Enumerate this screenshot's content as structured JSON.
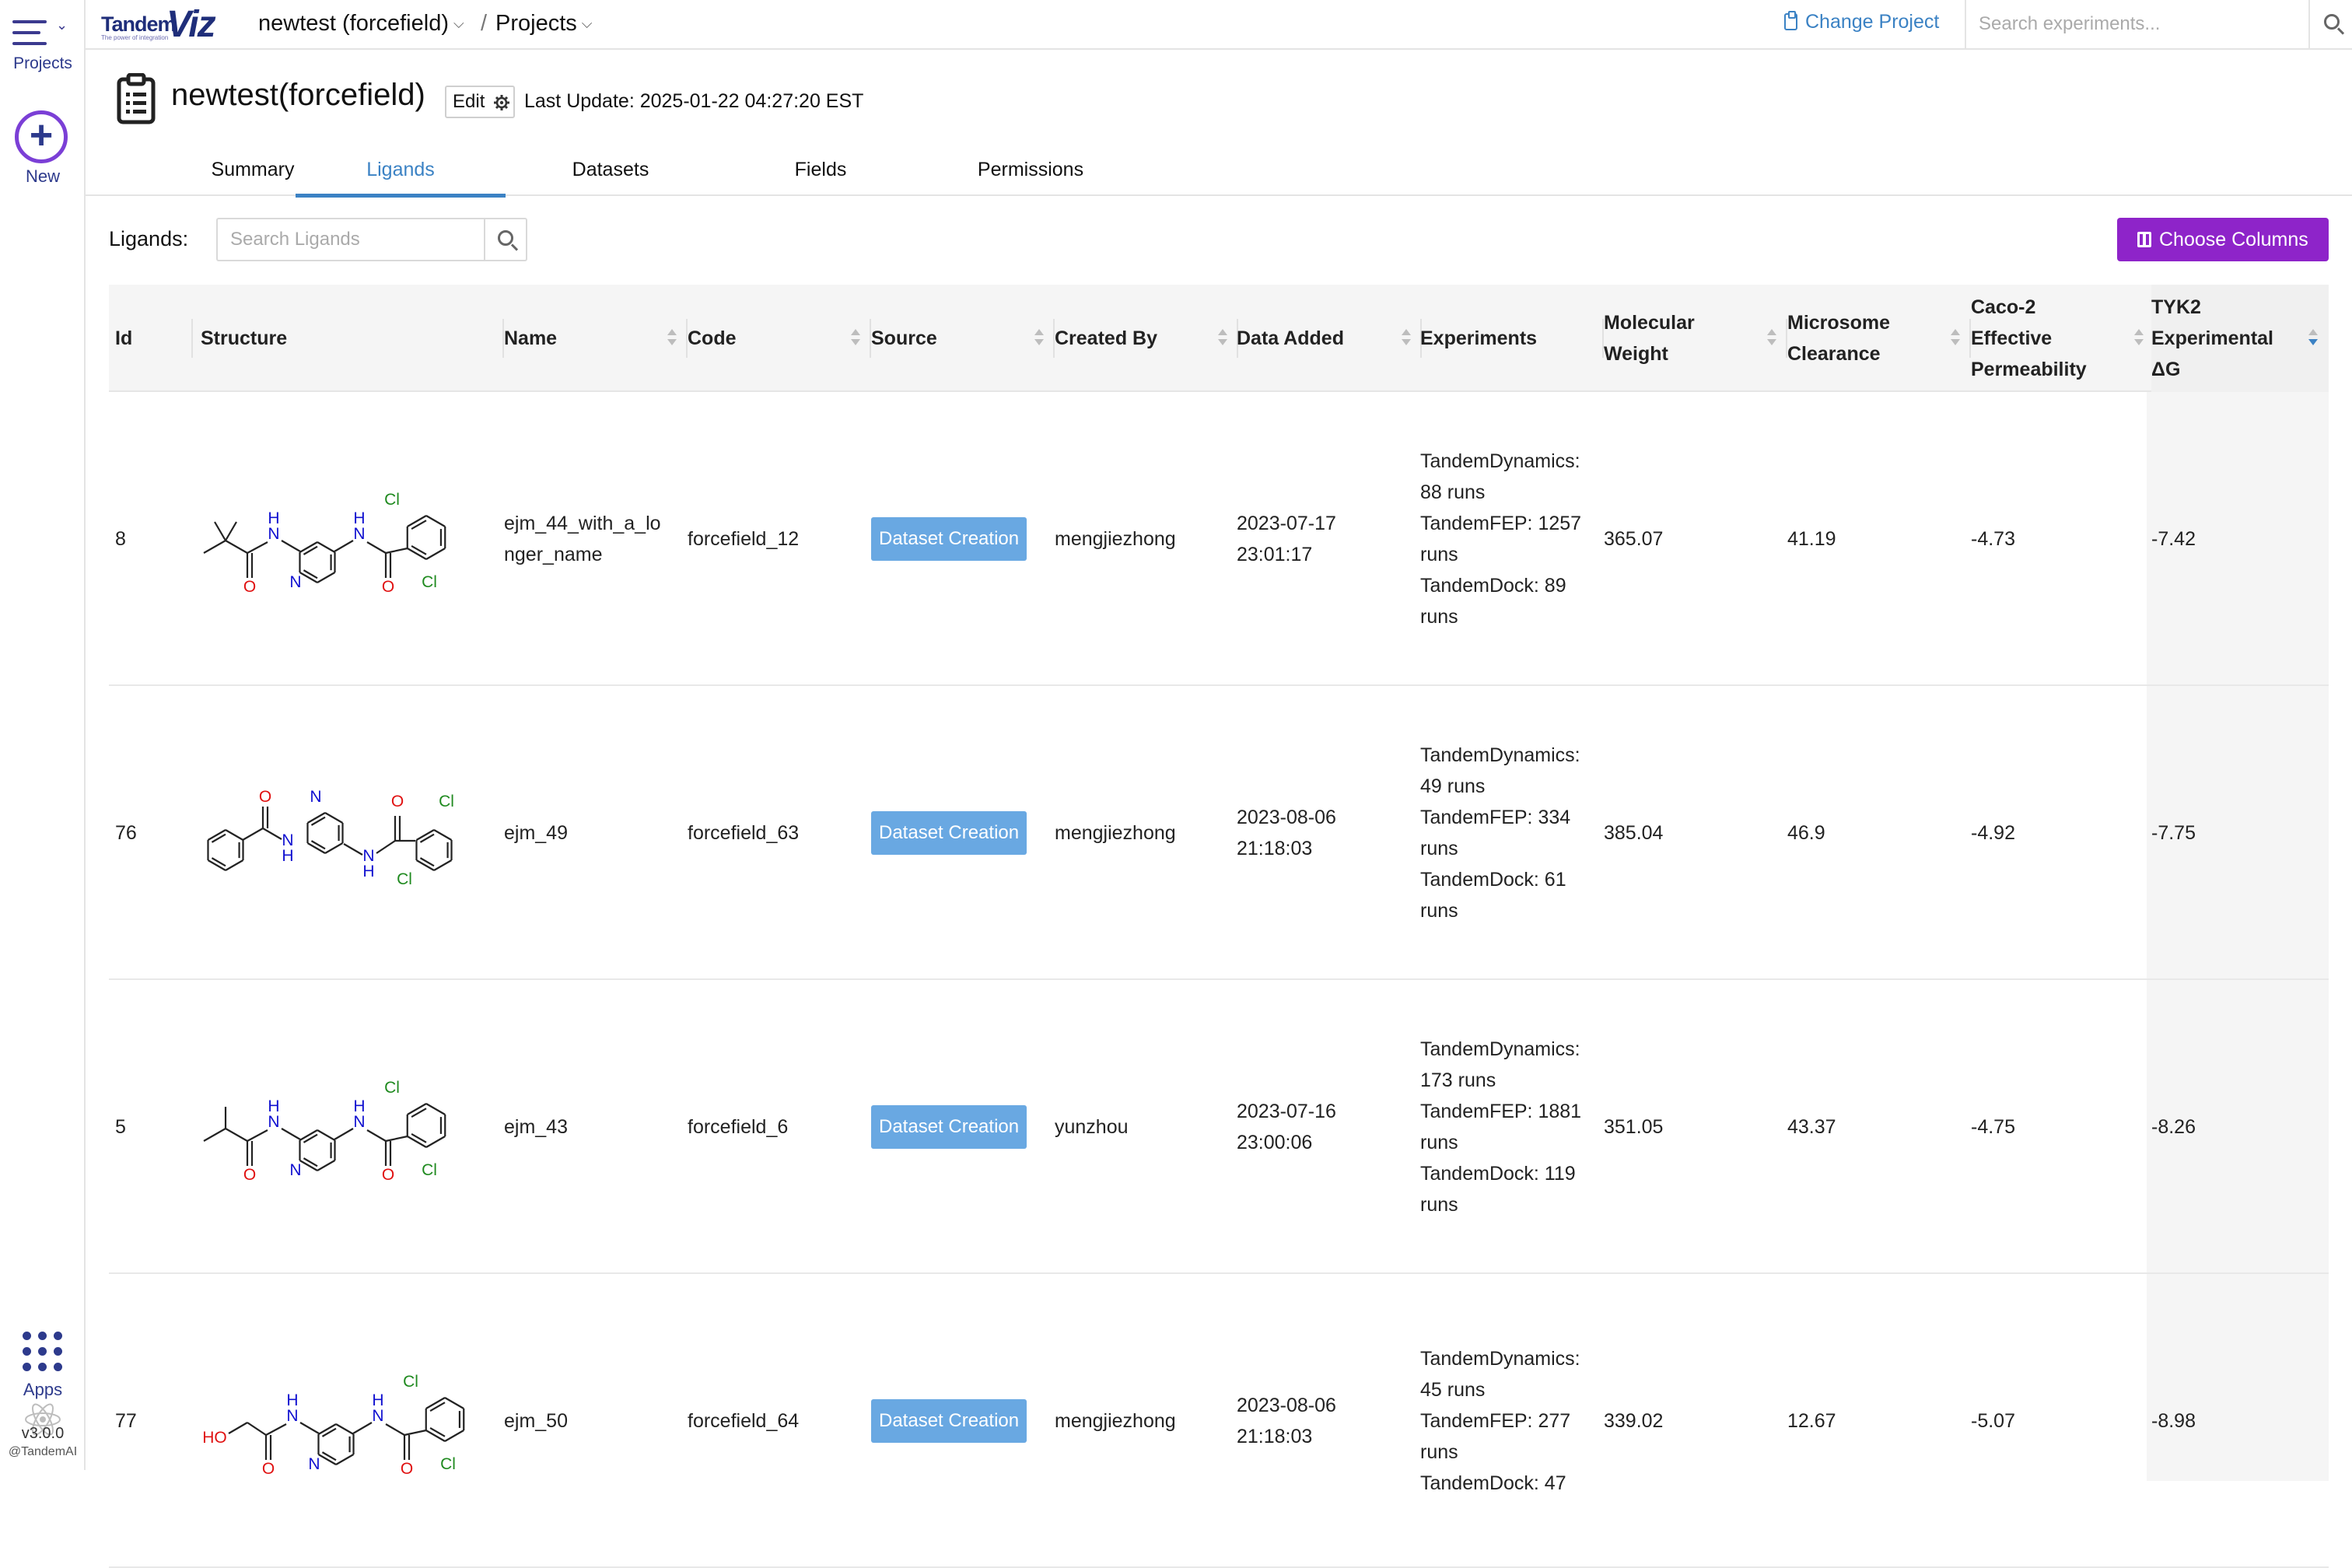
{
  "rail": {
    "projects_label": "Projects",
    "new_label": "New",
    "apps_label": "Apps",
    "version": "v3.0.0",
    "copyright": "@TandemAI"
  },
  "topbar": {
    "logo_tandem": "Tandem",
    "logo_viz": "Viz",
    "logo_tagline": "The power of integration",
    "breadcrumb_project": "newtest (forcefield)",
    "breadcrumb_separator": "/",
    "breadcrumb_projects": "Projects",
    "change_project": "Change Project",
    "search_placeholder": "Search experiments..."
  },
  "header": {
    "title": "newtest(forcefield)",
    "edit_label": "Edit",
    "last_update": "Last Update: 2025-01-22 04:27:20 EST"
  },
  "tabs": [
    {
      "label": "Summary",
      "active": false
    },
    {
      "label": "Ligands",
      "active": true
    },
    {
      "label": "Datasets",
      "active": false
    },
    {
      "label": "Fields",
      "active": false
    },
    {
      "label": "Permissions",
      "active": false
    }
  ],
  "toolbar": {
    "ligands_label": "Ligands:",
    "search_placeholder": "Search Ligands",
    "choose_columns": "Choose Columns"
  },
  "colors": {
    "accent": "#3b82c4",
    "brand": "#1f2e7a",
    "button_purple": "#8e24c9",
    "badge_blue": "#69a8e2",
    "atom_N": "#1010d0",
    "atom_O": "#e01010",
    "atom_Cl": "#1f8a1f"
  },
  "table": {
    "headers": {
      "id": "Id",
      "structure": "Structure",
      "name": "Name",
      "code": "Code",
      "source": "Source",
      "created_by": "Created By",
      "data_added": "Data Added",
      "experiments": "Experiments",
      "mw_1": "Molecular",
      "mw_2": "Weight",
      "mc_1": "Microsome",
      "mc_2": "Clearance",
      "caco_1": "Caco-2",
      "caco_2": "Effective",
      "caco_3": "Permeability",
      "tyk_1": "TYK2",
      "tyk_2": "Experimental",
      "tyk_3": "ΔG"
    },
    "sort": {
      "column": "TYK2 Experimental ΔG",
      "direction": "descending"
    },
    "rows": [
      {
        "id": "8",
        "name_1": "ejm_44_with_a_lo",
        "name_2": "nger_name",
        "code": "forcefield_12",
        "source": "Dataset Creation",
        "created_by": "mengjiezhong",
        "date_1": "2023-07-17",
        "date_2": "23:01:17",
        "exp": [
          "TandemDynamics:",
          "88 runs",
          "TandemFEP: 1257",
          "runs",
          "TandemDock: 89",
          "runs"
        ],
        "mw": "365.07",
        "mc": "41.19",
        "caco": "-4.73",
        "tyk2": "-7.42",
        "structure": {
          "substituent": "tert-butyl",
          "labels": {
            "n_amide_1": "N",
            "h_amide_1": "H",
            "n_amide_2": "N",
            "h_amide_2": "H",
            "n_pyr": "N",
            "o_1": "O",
            "o_2": "O",
            "cl_1": "Cl",
            "cl_2": "Cl"
          }
        }
      },
      {
        "id": "76",
        "name_1": "ejm_49",
        "name_2": "",
        "code": "forcefield_63",
        "source": "Dataset Creation",
        "created_by": "mengjiezhong",
        "date_1": "2023-08-06",
        "date_2": "21:18:03",
        "exp": [
          "TandemDynamics:",
          "49 runs",
          "TandemFEP: 334",
          "runs",
          "TandemDock: 61",
          "runs"
        ],
        "mw": "385.04",
        "mc": "46.9",
        "caco": "-4.92",
        "tyk2": "-7.75",
        "structure": {
          "substituent": "phenyl",
          "labels": {
            "n_amide_1": "N",
            "h_amide_1": "H",
            "n_amide_2": "N",
            "h_amide_2": "H",
            "n_pyr": "N",
            "o_1": "O",
            "o_2": "O",
            "cl_1": "Cl",
            "cl_2": "Cl"
          }
        }
      },
      {
        "id": "5",
        "name_1": "ejm_43",
        "name_2": "",
        "code": "forcefield_6",
        "source": "Dataset Creation",
        "created_by": "yunzhou",
        "date_1": "2023-07-16",
        "date_2": "23:00:06",
        "exp": [
          "TandemDynamics:",
          "173 runs",
          "TandemFEP: 1881",
          "runs",
          "TandemDock: 119",
          "runs"
        ],
        "mw": "351.05",
        "mc": "43.37",
        "caco": "-4.75",
        "tyk2": "-8.26",
        "structure": {
          "substituent": "isopropyl",
          "labels": {
            "n_amide_1": "N",
            "h_amide_1": "H",
            "n_amide_2": "N",
            "h_amide_2": "H",
            "n_pyr": "N",
            "o_1": "O",
            "o_2": "O",
            "cl_1": "Cl",
            "cl_2": "Cl"
          }
        }
      },
      {
        "id": "77",
        "name_1": "ejm_50",
        "name_2": "",
        "code": "forcefield_64",
        "source": "Dataset Creation",
        "created_by": "mengjiezhong",
        "date_1": "2023-08-06",
        "date_2": "21:18:03",
        "exp": [
          "TandemDynamics:",
          "45 runs",
          "TandemFEP: 277",
          "runs",
          "TandemDock: 47",
          ""
        ],
        "mw": "339.02",
        "mc": "12.67",
        "caco": "-5.07",
        "tyk2": "-8.98",
        "structure": {
          "substituent": "hydroxymethyl",
          "labels": {
            "n_amide_1": "N",
            "h_amide_1": "H",
            "n_amide_2": "N",
            "h_amide_2": "H",
            "n_pyr": "N",
            "o_1": "O",
            "o_2": "O",
            "cl_1": "Cl",
            "cl_2": "Cl",
            "ho": "HO"
          }
        }
      }
    ]
  }
}
